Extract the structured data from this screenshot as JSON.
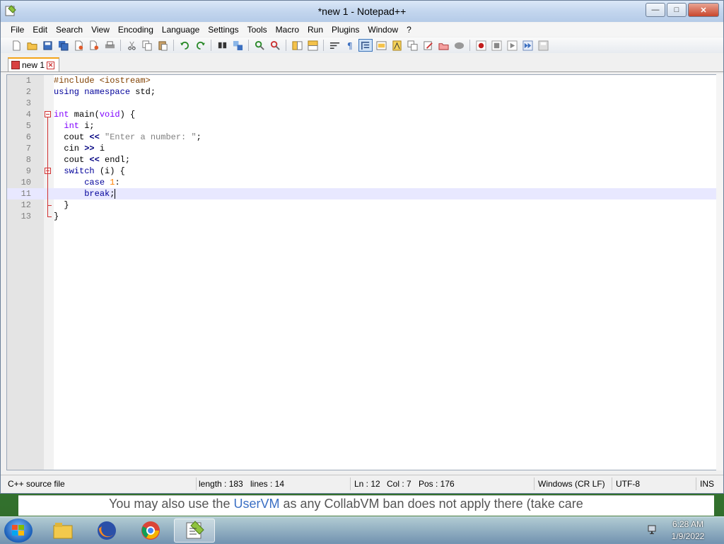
{
  "window": {
    "title": "*new 1 - Notepad++",
    "buttons": {
      "minimize": "—",
      "maximize": "□",
      "close": "✕"
    }
  },
  "menu": [
    "File",
    "Edit",
    "Search",
    "View",
    "Encoding",
    "Language",
    "Settings",
    "Tools",
    "Macro",
    "Run",
    "Plugins",
    "Window",
    "?"
  ],
  "toolbar_icons": [
    "new-file-icon",
    "open-file-icon",
    "save-icon",
    "save-all-icon",
    "close-icon",
    "close-all-icon",
    "print-icon",
    "cut-icon",
    "copy-icon",
    "paste-icon",
    "undo-icon",
    "redo-icon",
    "find-icon",
    "replace-icon",
    "zoom-in-icon",
    "zoom-out-icon",
    "sync-vertical-icon",
    "sync-horizontal-icon",
    "word-wrap-icon",
    "show-all-chars-icon",
    "indent-guide-icon",
    "user-defined-lang-icon",
    "doc-map-icon",
    "function-list-icon",
    "folder-as-workspace-icon",
    "doc-list-icon",
    "monitoring-icon",
    "record-macro-icon",
    "stop-macro-icon",
    "play-macro-icon",
    "run-macro-multiple-icon",
    "save-macro-icon"
  ],
  "tab": {
    "label": "new 1"
  },
  "code": {
    "lines": [
      {
        "n": "1",
        "tokens": [
          {
            "t": "pre",
            "v": "#include <iostream>"
          }
        ]
      },
      {
        "n": "2",
        "tokens": [
          {
            "t": "kw",
            "v": "using"
          },
          {
            "t": "id",
            "v": " "
          },
          {
            "t": "kw",
            "v": "namespace"
          },
          {
            "t": "id",
            "v": " std;"
          }
        ]
      },
      {
        "n": "3",
        "tokens": []
      },
      {
        "n": "4",
        "tokens": [
          {
            "t": "typ",
            "v": "int"
          },
          {
            "t": "id",
            "v": " main("
          },
          {
            "t": "typ",
            "v": "void"
          },
          {
            "t": "id",
            "v": ") {"
          }
        ]
      },
      {
        "n": "5",
        "tokens": [
          {
            "t": "id",
            "v": "  "
          },
          {
            "t": "typ",
            "v": "int"
          },
          {
            "t": "id",
            "v": " i;"
          }
        ]
      },
      {
        "n": "6",
        "tokens": [
          {
            "t": "id",
            "v": "  cout "
          },
          {
            "t": "op",
            "v": "<<"
          },
          {
            "t": "id",
            "v": " "
          },
          {
            "t": "str",
            "v": "\"Enter a number: \""
          },
          {
            "t": "id",
            "v": ";"
          }
        ]
      },
      {
        "n": "7",
        "tokens": [
          {
            "t": "id",
            "v": "  cin "
          },
          {
            "t": "op",
            "v": ">>"
          },
          {
            "t": "id",
            "v": " i"
          }
        ]
      },
      {
        "n": "8",
        "tokens": [
          {
            "t": "id",
            "v": "  cout "
          },
          {
            "t": "op",
            "v": "<<"
          },
          {
            "t": "id",
            "v": " endl;"
          }
        ]
      },
      {
        "n": "9",
        "tokens": [
          {
            "t": "id",
            "v": "  "
          },
          {
            "t": "kw",
            "v": "switch"
          },
          {
            "t": "id",
            "v": " (i) {"
          }
        ]
      },
      {
        "n": "10",
        "tokens": [
          {
            "t": "id",
            "v": "      "
          },
          {
            "t": "kw",
            "v": "case"
          },
          {
            "t": "id",
            "v": " "
          },
          {
            "t": "num",
            "v": "1"
          },
          {
            "t": "id",
            "v": ":"
          }
        ]
      },
      {
        "n": "11",
        "tokens": [
          {
            "t": "id",
            "v": "      "
          },
          {
            "t": "kw",
            "v": "break"
          },
          {
            "t": "id",
            "v": ";"
          }
        ]
      },
      {
        "n": "12",
        "tokens": [
          {
            "t": "id",
            "v": "  }"
          }
        ]
      },
      {
        "n": "13",
        "tokens": [
          {
            "t": "id",
            "v": "}"
          }
        ]
      }
    ],
    "current_line": "11"
  },
  "status": {
    "file_type": "C++ source file",
    "length": "length : 183",
    "lines": "lines : 14",
    "ln": "Ln : 12",
    "col": "Col : 7",
    "pos": "Pos : 176",
    "eol": "Windows (CR LF)",
    "encoding": "UTF-8",
    "mode": "INS"
  },
  "notice": {
    "before": "You may also use the ",
    "link": "UserVM",
    "after": " as any CollabVM ban does not apply there (take care"
  },
  "taskbar": {
    "apps": [
      "explorer-icon",
      "firefox-icon",
      "chrome-icon",
      "notepadpp-icon"
    ],
    "time": "6:28 AM",
    "date": "1/9/2022"
  },
  "colors": {
    "keyword": "#00009a",
    "type": "#8000ff",
    "preprocessor": "#804000",
    "string": "#808080",
    "number": "#ff8000",
    "current_line_bg": "#e8e8ff",
    "fold_marker": "#d03030"
  }
}
